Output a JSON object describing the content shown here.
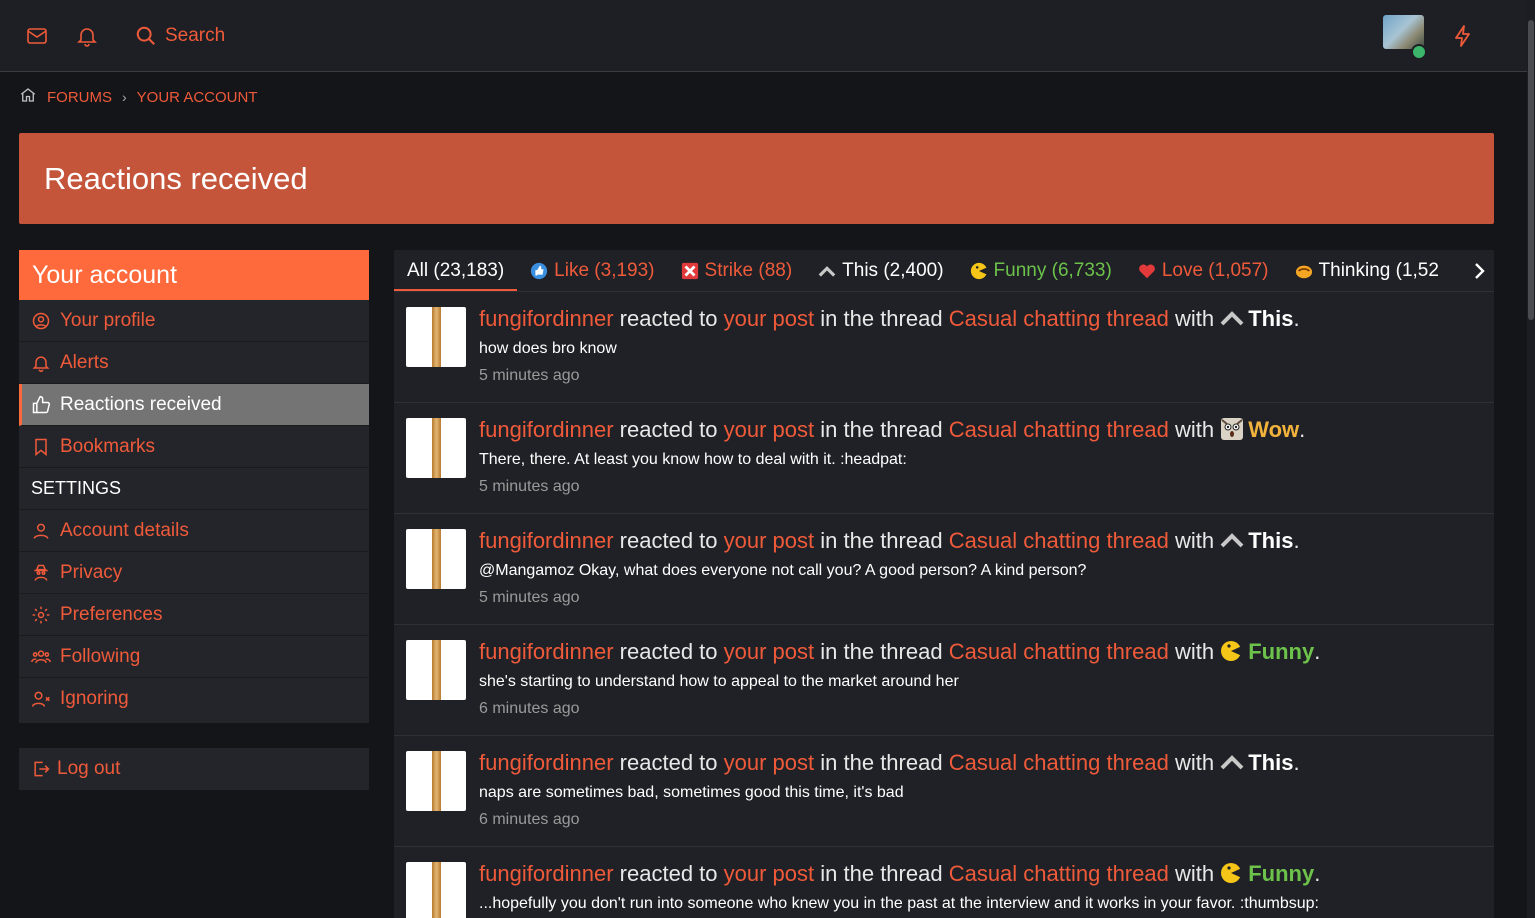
{
  "topbar": {
    "search_label": "Search",
    "icons": [
      "mail-icon",
      "bell-icon",
      "search-icon",
      "bolt-icon"
    ],
    "accent": "#ef5a3a",
    "online_color": "#3bb66a"
  },
  "breadcrumb": {
    "items": [
      "FORUMS",
      "YOUR ACCOUNT"
    ]
  },
  "banner": {
    "title": "Reactions received",
    "color": "#c4543a"
  },
  "sidebar": {
    "header": "Your account",
    "items": [
      {
        "label": "Your profile",
        "icon": "user-circle-icon"
      },
      {
        "label": "Alerts",
        "icon": "bell-icon"
      },
      {
        "label": "Reactions received",
        "icon": "thumbs-up-icon",
        "active": true
      },
      {
        "label": "Bookmarks",
        "icon": "bookmark-icon"
      }
    ],
    "settings_label": "SETTINGS",
    "settings_items": [
      {
        "label": "Account details",
        "icon": "user-icon"
      },
      {
        "label": "Privacy",
        "icon": "user-secret-icon"
      },
      {
        "label": "Preferences",
        "icon": "cog-icon"
      },
      {
        "label": "Following",
        "icon": "users-icon"
      },
      {
        "label": "Ignoring",
        "icon": "user-times-icon"
      }
    ],
    "logout_label": "Log out"
  },
  "tabs": [
    {
      "label": "All (23,183)",
      "color": "#ffffff",
      "active": true
    },
    {
      "label": "Like (3,193)",
      "color": "#ef5a3a",
      "icon": "like-emoji-icon"
    },
    {
      "label": "Strike (88)",
      "color": "#ef5a3a",
      "icon": "strike-x-icon"
    },
    {
      "label": "This (2,400)",
      "color": "#ffffff",
      "icon": "this-chevron-icon"
    },
    {
      "label": "Funny (6,733)",
      "color": "#6cc24a",
      "icon": "funny-emoji-icon"
    },
    {
      "label": "Love (1,057)",
      "color": "#ef5a3a",
      "icon": "love-heart-icon"
    },
    {
      "label": "Thinking (1,52",
      "color": "#ffffff",
      "icon": "thinking-emoji-icon"
    }
  ],
  "reactions": [
    {
      "user": "fungifordinner",
      "t1": "reacted to",
      "post_link": "your post",
      "t2": "in the thread",
      "thread": "Casual chatting thread",
      "t3": "with",
      "reaction": "This",
      "type": "this",
      "snippet": "how does bro know",
      "time": "5 minutes ago"
    },
    {
      "user": "fungifordinner",
      "t1": "reacted to",
      "post_link": "your post",
      "t2": "in the thread",
      "thread": "Casual chatting thread",
      "t3": "with",
      "reaction": "Wow",
      "type": "wow",
      "snippet": "There, there. At least you know how to deal with it. :headpat:",
      "time": "5 minutes ago"
    },
    {
      "user": "fungifordinner",
      "t1": "reacted to",
      "post_link": "your post",
      "t2": "in the thread",
      "thread": "Casual chatting thread",
      "t3": "with",
      "reaction": "This",
      "type": "this",
      "snippet": "@Mangamoz Okay, what does everyone not call you? A good person? A kind person?",
      "time": "5 minutes ago"
    },
    {
      "user": "fungifordinner",
      "t1": "reacted to",
      "post_link": "your post",
      "t2": "in the thread",
      "thread": "Casual chatting thread",
      "t3": "with",
      "reaction": "Funny",
      "type": "funny",
      "snippet": "she's starting to understand how to appeal to the market around her",
      "time": "6 minutes ago"
    },
    {
      "user": "fungifordinner",
      "t1": "reacted to",
      "post_link": "your post",
      "t2": "in the thread",
      "thread": "Casual chatting thread",
      "t3": "with",
      "reaction": "This",
      "type": "this",
      "snippet": "naps are sometimes bad, sometimes good this time, it's bad",
      "time": "6 minutes ago"
    },
    {
      "user": "fungifordinner",
      "t1": "reacted to",
      "post_link": "your post",
      "t2": "in the thread",
      "thread": "Casual chatting thread",
      "t3": "with",
      "reaction": "Funny",
      "type": "funny",
      "snippet": "...hopefully you don't run into someone who knew you in the past at the interview and it works in your favor. :thumbsup:",
      "time": "6 minutes ago"
    }
  ]
}
